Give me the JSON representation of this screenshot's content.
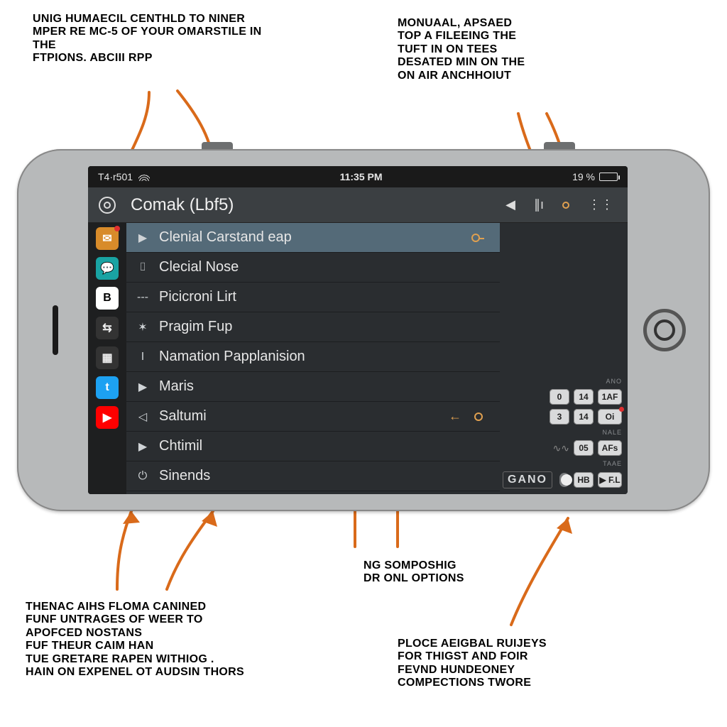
{
  "callouts": {
    "top_left": "UNIG HUMAECIL CENTHLD TO NINER\nMPER RE MC-5 OF YOUR OMARSTILE IN\nTHE\nFTPIONS. ABCIII RPP",
    "top_right": "MONUAAL, APSAED\nTOP A FILEEING THE\nTUFT IN ON TEES\nDESATED MIN ON THE\nON AIR ANCHHOIUT",
    "mid_right": "NG SOMPOSHIG\nDR ONL OPTIONS",
    "bottom_left": "THENAC AIHS FLOMA CANINED\nFUNF UNTRAGES OF WEER TO\nAPOFCED NOSTANS\nFUF THEUR  CAIM HAN\nTUE GRETARE RAPEN  WITHIOG .\nHAIN ON EXPENEL OT AUDSIN THORS",
    "bottom_right": "PLOCE AEIGBAL RUIJEYS\nFOR THIGST AND FOIR\nFEVND HUNDEONEY\nCOMPECTIONS TWORE"
  },
  "statusbar": {
    "carrier": "T4·r501",
    "time": "11:35 PM",
    "battery_pct": "19 %"
  },
  "header": {
    "title": "Comak (Lbf5)"
  },
  "sidebar_icons": [
    "gear",
    "inbox",
    "chat",
    "B",
    "share",
    "grid",
    "tw",
    "yt"
  ],
  "list": [
    {
      "icon": "▶",
      "label": "Clenial Carstand  eap",
      "selected": true,
      "loop": true
    },
    {
      "icon": "⌷",
      "label": "Clecial Nose"
    },
    {
      "icon": "---",
      "label": "Picicroni Lirt"
    },
    {
      "icon": "✶",
      "label": "Pragim Fup"
    },
    {
      "icon": "I",
      "label": "Namation Papplanision"
    },
    {
      "icon": "▶",
      "label": "Maris"
    },
    {
      "icon": "◁",
      "label": "Saltumi",
      "arrow_in": true,
      "dot": true
    },
    {
      "icon": "▶",
      "label": "Chtimil"
    },
    {
      "icon": "⏻",
      "label": "Sinends"
    }
  ],
  "right_controls": {
    "row1_top_label": "ANO",
    "row1": [
      "0",
      "14",
      "1AF"
    ],
    "row2": [
      "3",
      "14",
      "Oi"
    ],
    "row3_label": "NALE",
    "row3": [
      "~",
      "05",
      "AFs"
    ],
    "gano_label": "GANO",
    "row4": [
      "HB",
      "▶ F.L"
    ],
    "row4_top_label": "TAAE"
  }
}
